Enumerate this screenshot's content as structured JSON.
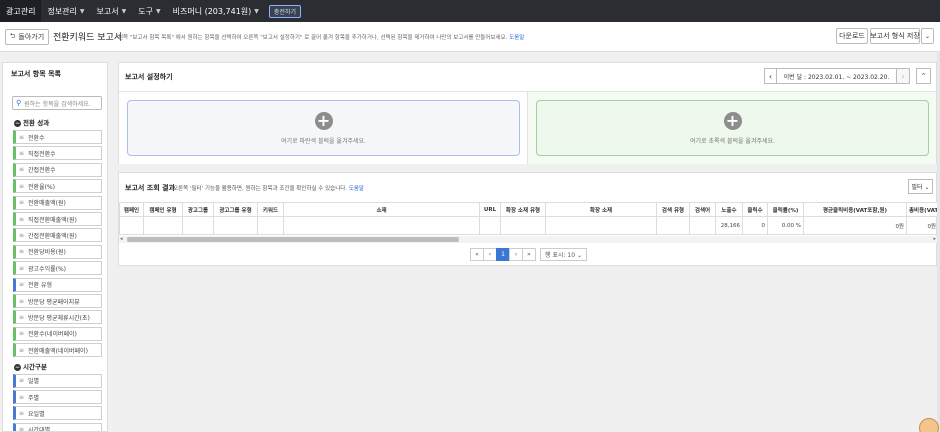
{
  "topnav": {
    "items": [
      {
        "label": "광고관리",
        "caret": false
      },
      {
        "label": "정보관리",
        "caret": true
      },
      {
        "label": "보고서",
        "caret": true
      },
      {
        "label": "도구",
        "caret": true
      },
      {
        "label": "비즈머니 (203,741원)",
        "caret": true
      }
    ],
    "charge_label": "충전하기"
  },
  "header": {
    "back_label": "돌아가기",
    "title": "전환키워드 보고서",
    "desc_prefix": "왼쪽 \"보고서 항목 목록\" 에서 원하는 항목을 선택하여 오른쪽 \"보고서 설정하기\" 로 끌어 옮겨 항목을 추가하거나, 선택된 항목을 제거하여 나만의 보고서를 만들어보세요.",
    "help_link": "도움말",
    "download_label": "다운로드",
    "save_label": "보고서 형식 저장",
    "more_label": "⌄"
  },
  "sidebar": {
    "title": "보고서 항목 목록",
    "search_placeholder": "원하는 항목을 검색하세요.",
    "groups": [
      {
        "label": "전환 성과",
        "items": [
          {
            "label": "전환수",
            "color": "green"
          },
          {
            "label": "직접전환수",
            "color": "green"
          },
          {
            "label": "간접전환수",
            "color": "green"
          },
          {
            "label": "전환율(%)",
            "color": "green"
          },
          {
            "label": "전환매출액(원)",
            "color": "green"
          },
          {
            "label": "직접전환매출액(원)",
            "color": "green"
          },
          {
            "label": "간접전환매출액(원)",
            "color": "green"
          },
          {
            "label": "전환당비용(원)",
            "color": "green"
          },
          {
            "label": "광고수익률(%)",
            "color": "green"
          },
          {
            "label": "전환 유형",
            "color": "blue"
          },
          {
            "label": "방문당 평균페이지뷰",
            "color": "green"
          },
          {
            "label": "방문당 평균체류시간(초)",
            "color": "green"
          },
          {
            "label": "전환수(네이버페이)",
            "color": "green"
          },
          {
            "label": "전환매출액(네이버페이)",
            "color": "green"
          }
        ]
      },
      {
        "label": "시간구분",
        "items": [
          {
            "label": "일별",
            "color": "blue"
          },
          {
            "label": "주별",
            "color": "blue"
          },
          {
            "label": "요일별",
            "color": "blue"
          },
          {
            "label": "시간대별",
            "color": "blue"
          }
        ]
      }
    ]
  },
  "settings": {
    "title": "보고서 설정하기",
    "date_range": "이번 달 : 2023.02.01. ~ 2023.02.20.",
    "prev_label": "‹",
    "next_label": "›",
    "collapse_label": "⌃",
    "left_zone_text": "여기로 파란색 블럭을 옮겨주세요.",
    "right_zone_text": "여기로 초록색 블럭을 옮겨주세요."
  },
  "results": {
    "title": "보고서 조회 결과",
    "desc": "오른쪽 '필터' 기능을 활용하면, 원하는 항목과 조건을 확인하실 수 있습니다.",
    "help_link": "도움말",
    "filter_label": "필터 ⌄",
    "columns": [
      "캠페인",
      "캠페인 유형",
      "광고그룹",
      "광고그룹 유형",
      "키워드",
      "소재",
      "URL",
      "확장 소재 유형",
      "확장 소재",
      "검색 유형",
      "검색어",
      "노출수",
      "클릭수",
      "클릭률(%)",
      "평균클릭비용(VAT포함,원)",
      "총비용(VAT포함,원)"
    ],
    "row": [
      "",
      "",
      "",
      "",
      "",
      "",
      "",
      "",
      "",
      "",
      "",
      "28,166",
      "0",
      "0.00 %",
      "0원",
      "0원"
    ],
    "pager": {
      "first": "«",
      "prev": "‹",
      "current": "1",
      "next": "›",
      "last": "»",
      "per_page": "행 표시: 10 ⌄"
    }
  }
}
